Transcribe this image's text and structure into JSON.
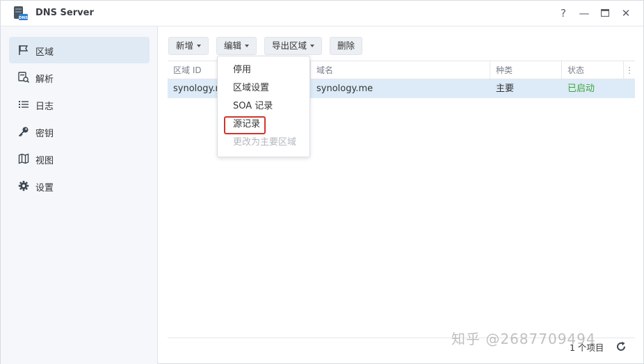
{
  "window": {
    "title": "DNS Server",
    "controls": {
      "help": "?",
      "minimize": "—",
      "maximize": "▭",
      "close": "✕"
    }
  },
  "sidebar": {
    "items": [
      {
        "label": "区域",
        "icon": "flag-icon",
        "active": true
      },
      {
        "label": "解析",
        "icon": "resolve-icon",
        "active": false
      },
      {
        "label": "日志",
        "icon": "list-icon",
        "active": false
      },
      {
        "label": "密钥",
        "icon": "key-icon",
        "active": false
      },
      {
        "label": "视图",
        "icon": "map-icon",
        "active": false
      },
      {
        "label": "设置",
        "icon": "gear-icon",
        "active": false
      }
    ]
  },
  "toolbar": {
    "create": "新增",
    "edit": "编辑",
    "export_zone": "导出区域",
    "delete": "删除"
  },
  "grid": {
    "columns": [
      "区域 ID",
      "",
      "域名",
      "种类",
      "状态"
    ],
    "rows": [
      {
        "zone_id": "synology.r",
        "domain": "synology.me",
        "type": "主要",
        "status": "已启动"
      }
    ]
  },
  "edit_menu": {
    "items": [
      {
        "label": "停用",
        "disabled": false
      },
      {
        "label": "区域设置",
        "disabled": false
      },
      {
        "label": "SOA 记录",
        "disabled": false
      },
      {
        "label": "源记录",
        "disabled": false,
        "highlighted": true
      },
      {
        "label": "更改为主要区域",
        "disabled": true
      }
    ]
  },
  "footer": {
    "item_count": "1 个项目"
  },
  "watermark": "知乎 @2687709494",
  "colors": {
    "accent_selection": "#dcebf7",
    "status_running": "#3aa537",
    "highlight_box": "#d0342c"
  }
}
